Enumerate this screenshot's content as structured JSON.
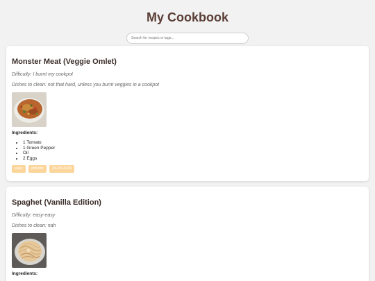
{
  "header": {
    "title": "My Cookbook"
  },
  "search": {
    "placeholder": "Search for recipes or tags..."
  },
  "recipes": [
    {
      "title": "Monster Meat (Veggie Omlet)",
      "difficulty": "Difficulty: I burnt my cookpot",
      "dishes": "Dishes to clean: not that hard, unless you burnt veggies in a cookpot",
      "photo": "omelet-photo",
      "ingredients_heading": "Ingredients:",
      "ingredients": [
        "1 Tomato",
        "1 Green Pepper",
        "Oil",
        "2 Eggs"
      ],
      "tags": [
        "easy",
        "omlette",
        "29-09-2024"
      ]
    },
    {
      "title": "Spaghet (Vanilla Edition)",
      "difficulty": "Difficulty: easy-easy",
      "dishes": "Dishes to clean: nah",
      "photo": "spaghetti-photo",
      "ingredients_heading": "Ingredients:"
    }
  ],
  "colors": {
    "background": "#f2f2f2",
    "title": "#5a3e36",
    "tag": "#fcd59a"
  }
}
